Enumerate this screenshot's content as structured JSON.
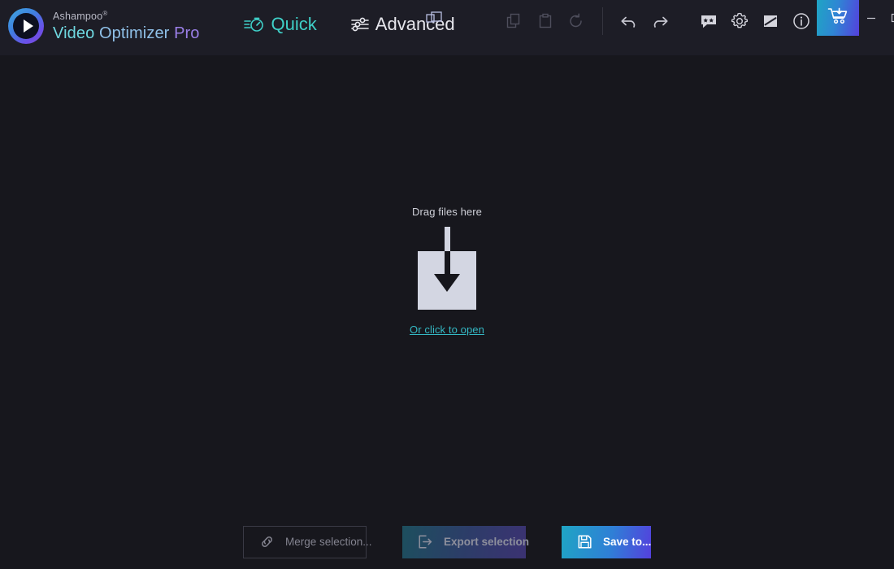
{
  "app": {
    "brand_superscript": "Ashampoo",
    "brand_reg": "®",
    "brand_word1": "Video",
    "brand_word2": "Optimizer",
    "brand_word3": "Pro",
    "logo_icon": "play-circle-icon"
  },
  "nav": {
    "tabs": [
      {
        "label": "Quick",
        "icon": "stopwatch-icon",
        "active": true
      },
      {
        "label": "Advanced",
        "icon": "sliders-icon",
        "active": false
      }
    ]
  },
  "toolbar": {
    "left_group": [
      {
        "name": "copy-button",
        "icon": "copy-icon",
        "enabled": false
      },
      {
        "name": "paste-button",
        "icon": "clipboard-icon",
        "enabled": false
      },
      {
        "name": "reset-button",
        "icon": "reset-circular-arrow-icon",
        "enabled": false
      }
    ],
    "history_group": [
      {
        "name": "undo-button",
        "icon": "undo-arrow-icon",
        "enabled": true
      },
      {
        "name": "redo-button",
        "icon": "redo-arrow-icon",
        "enabled": true
      }
    ],
    "right_group": [
      {
        "name": "feedback-button",
        "icon": "rating-speech-bubble-icon",
        "enabled": true
      },
      {
        "name": "settings-button",
        "icon": "gear-icon",
        "enabled": true
      },
      {
        "name": "theme-button",
        "icon": "theme-contrast-icon",
        "enabled": true
      },
      {
        "name": "info-button",
        "icon": "info-circle-icon",
        "enabled": true
      }
    ],
    "cart": {
      "name": "buy-cart-button",
      "icon": "shopping-cart-download-icon"
    }
  },
  "window_controls": {
    "minimize": "–",
    "maximize": "□",
    "close": "✕"
  },
  "dropzone": {
    "title": "Drag files here",
    "link": "Or click to open",
    "icon": "download-into-box-icon"
  },
  "actions": {
    "merge": {
      "label": "Merge selection...",
      "icon": "chain-link-icon",
      "enabled": false
    },
    "export": {
      "label": "Export selection",
      "icon": "export-arrow-icon",
      "enabled": false
    },
    "save": {
      "label": "Save to...",
      "icon": "floppy-save-icon",
      "enabled": true
    }
  },
  "colors": {
    "titlebar_bg": "#1d1d26",
    "app_bg": "#17171d",
    "accent_teal": "#3fd0c8",
    "link_teal": "#34b8c4",
    "gradient_start": "#1fa5c4",
    "gradient_end": "#5440dd",
    "drop_box": "#d3d6e2"
  }
}
